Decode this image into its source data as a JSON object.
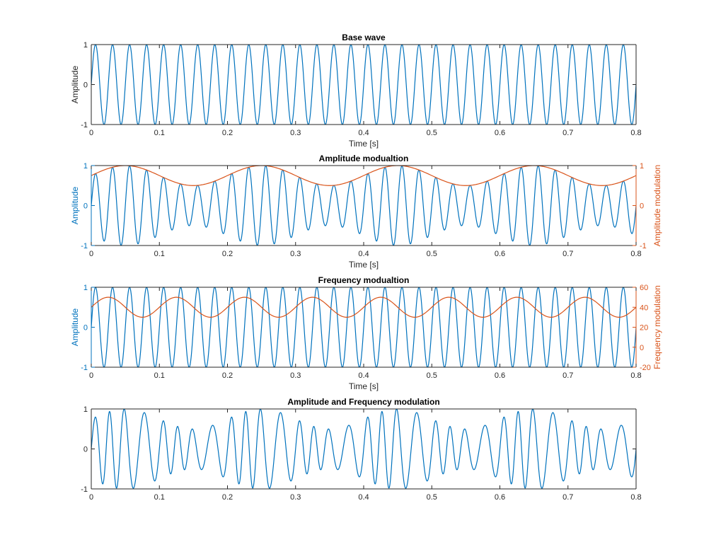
{
  "colors": {
    "series_primary": "#0072BD",
    "series_secondary": "#D95319",
    "axis": "#262626",
    "background": "#ffffff"
  },
  "chart_data": [
    {
      "type": "line",
      "title": "Base wave",
      "xlabel": "Time [s]",
      "ylabel": "Amplitude",
      "xlim": [
        0,
        0.8
      ],
      "ylim": [
        -1,
        1
      ],
      "xticks": [
        "0",
        "0.1",
        "0.2",
        "0.3",
        "0.4",
        "0.5",
        "0.6",
        "0.7",
        "0.8"
      ],
      "yticks": [
        "-1",
        "0",
        "1"
      ],
      "grid": false,
      "series": [
        {
          "axis": "left",
          "function": "sin",
          "amplitude": 1,
          "frequency_hz": 40,
          "phase_rad": 0,
          "x_start": 0,
          "x_end": 0.8,
          "points": 1601
        }
      ]
    },
    {
      "type": "line",
      "title": "Amplitude modualtion",
      "xlabel": "Time [s]",
      "ylabel": "Amplitude",
      "ylabel_right": "Amplitude modulation",
      "xlim": [
        0,
        0.8
      ],
      "ylim": [
        -1,
        1
      ],
      "ylim_right": [
        -1,
        1
      ],
      "xticks": [
        "0",
        "0.1",
        "0.2",
        "0.3",
        "0.4",
        "0.5",
        "0.6",
        "0.7",
        "0.8"
      ],
      "yticks": [
        "-1",
        "0",
        "1"
      ],
      "yticks_right": [
        "-1",
        "0",
        "1"
      ],
      "grid": false,
      "series": [
        {
          "axis": "left",
          "function": "am_carrier",
          "carrier_hz": 40,
          "envelope_offset": 0.75,
          "envelope_amplitude": 0.25,
          "envelope_hz": 5,
          "x_start": 0,
          "x_end": 0.8,
          "points": 1601
        },
        {
          "axis": "right",
          "function": "envelope",
          "offset": 0.75,
          "amplitude": 0.25,
          "frequency_hz": 5,
          "x_start": 0,
          "x_end": 0.8,
          "points": 401
        }
      ]
    },
    {
      "type": "line",
      "title": "Frequency modualtion",
      "xlabel": "Time [s]",
      "ylabel": "Amplitude",
      "ylabel_right": "Frequency modulation",
      "xlim": [
        0,
        0.8
      ],
      "ylim": [
        -1,
        1
      ],
      "ylim_right": [
        -20,
        60
      ],
      "xticks": [
        "0",
        "0.1",
        "0.2",
        "0.3",
        "0.4",
        "0.5",
        "0.6",
        "0.7",
        "0.8"
      ],
      "yticks": [
        "-1",
        "0",
        "1"
      ],
      "yticks_right": [
        "-20",
        "0",
        "20",
        "40",
        "60"
      ],
      "grid": false,
      "series": [
        {
          "axis": "left",
          "function": "sin",
          "amplitude": 1,
          "frequency_hz": 40,
          "phase_rad": 0,
          "x_start": 0,
          "x_end": 0.8,
          "points": 1601
        },
        {
          "axis": "right",
          "function": "frequency",
          "offset": 40,
          "amplitude": 10,
          "frequency_hz": 10,
          "x_start": 0,
          "x_end": 0.8,
          "points": 401
        }
      ]
    },
    {
      "type": "line",
      "title": "Amplitude and Frequency modulation",
      "xlabel": "",
      "ylabel": "",
      "xlim": [
        0,
        0.8
      ],
      "ylim": [
        -1,
        1
      ],
      "xticks": [
        "0",
        "0.1",
        "0.2",
        "0.3",
        "0.4",
        "0.5",
        "0.6",
        "0.7",
        "0.8"
      ],
      "yticks": [
        "-1",
        "0",
        "1"
      ],
      "grid": false,
      "series": [
        {
          "axis": "left",
          "function": "am_fm",
          "center_hz": 40,
          "deviation_hz": 10,
          "mod_hz": 10,
          "envelope_offset": 0.75,
          "envelope_amplitude": 0.25,
          "envelope_hz": 5,
          "x_start": 0,
          "x_end": 0.8,
          "points": 2001
        }
      ]
    }
  ]
}
